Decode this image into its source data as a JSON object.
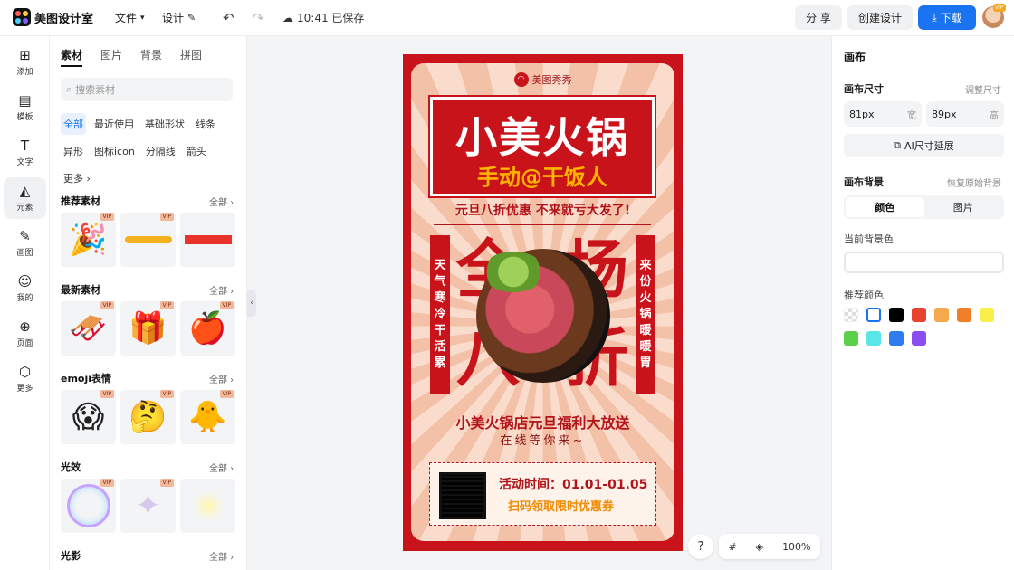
{
  "app": {
    "name": "美图设计室"
  },
  "topbar": {
    "file_menu": "文件",
    "design_menu": "设计",
    "save_status": "10:41 已保存",
    "share": "分 享",
    "create_design": "创建设计",
    "download": "下载",
    "avatar_badge": "VIP"
  },
  "rail": {
    "items": [
      {
        "label": "添加",
        "icon": "plus-square-icon"
      },
      {
        "label": "模板",
        "icon": "template-icon"
      },
      {
        "label": "文字",
        "icon": "text-icon"
      },
      {
        "label": "元素",
        "icon": "elements-icon"
      },
      {
        "label": "画图",
        "icon": "draw-icon"
      },
      {
        "label": "我的",
        "icon": "user-icon"
      },
      {
        "label": "页面",
        "icon": "page-add-icon"
      },
      {
        "label": "更多",
        "icon": "cube-icon"
      }
    ]
  },
  "panel": {
    "tabs": [
      "素材",
      "图片",
      "背景",
      "拼图"
    ],
    "search_placeholder": "搜索素材",
    "chips": [
      "全部",
      "最近使用",
      "基础形状",
      "线条",
      "异形",
      "图标icon",
      "分隔线",
      "箭头",
      "更多"
    ],
    "sections": [
      {
        "title": "推荐素材",
        "all": "全部"
      },
      {
        "title": "最新素材",
        "all": "全部"
      },
      {
        "title": "emoji表情",
        "all": "全部"
      },
      {
        "title": "光效",
        "all": "全部"
      },
      {
        "title": "光影",
        "all": "全部"
      }
    ],
    "vip_badge": "VIP"
  },
  "poster": {
    "brand": "美图秀秀",
    "title": "小美火锅",
    "subtitle": "手动@干饭人",
    "promo": "元旦八折优惠 不来就亏大发了!",
    "big_chars": [
      "全",
      "场",
      "八",
      "折"
    ],
    "left_vertical": "天气寒冷干活累",
    "right_vertical": "来份火锅暖暖胃",
    "offer": "小美火锅店元旦福利大放送",
    "wait": "在线等你来~",
    "event_time": "活动时间：01.01-01.05",
    "coupon": "扫码领取限时优惠券"
  },
  "canvas": {
    "zoom": "100%"
  },
  "rpanel": {
    "title": "画布",
    "size_label": "画布尺寸",
    "adjust_size": "调整尺寸",
    "width_value": "81px",
    "width_unit": "宽",
    "height_value": "89px",
    "height_unit": "高",
    "ai_extend": "AI尺寸延展",
    "bg_label": "画布背景",
    "restore_bg": "恢复原始背景",
    "seg_color": "颜色",
    "seg_image": "图片",
    "current_bg": "当前背景色",
    "recommended": "推荐颜色",
    "swatches": [
      "transparent",
      "#ffffff",
      "#000000",
      "#e8432e",
      "#f5a94d",
      "#f07f28",
      "#f8ef4a",
      "#5cd04a",
      "#58e6e6",
      "#2f7cf0",
      "#8a4ef0"
    ]
  }
}
